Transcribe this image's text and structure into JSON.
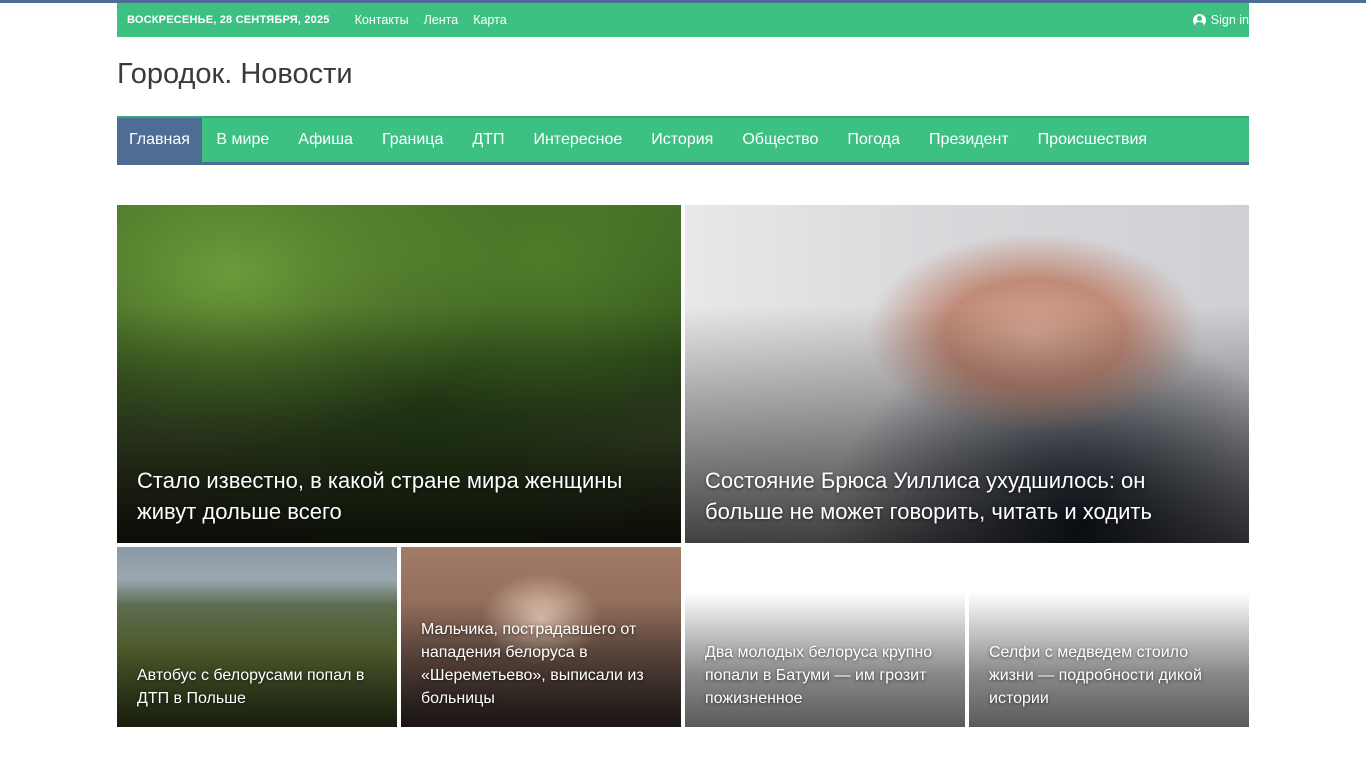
{
  "topbar": {
    "date": "Воскресенье, 28 сентября, 2025",
    "links": [
      "Контакты",
      "Лента",
      "Карта"
    ],
    "signin": "Sign in",
    "colors": {
      "bar": "#3cc182",
      "accent": "#4d6d94"
    }
  },
  "site": {
    "title": "Городок. Новости"
  },
  "nav": {
    "items": [
      "Главная",
      "В мире",
      "Афиша",
      "Граница",
      "ДТП",
      "Интересное",
      "История",
      "Общество",
      "Погода",
      "Президент",
      "Происшествия"
    ],
    "active_index": 0
  },
  "news": {
    "big": [
      {
        "title": "Стало известно, в какой стране мира женщины живут дольше всего",
        "image": "woman-on-bench-park"
      },
      {
        "title": "Состояние Брюса Уиллиса ухудшилось: он больше не может говорить, читать и ходить",
        "image": "bruce-willis-portrait"
      }
    ],
    "small": [
      {
        "title": "Автобус с белорусами попал в ДТП в Польше",
        "image": "bus-road-accident"
      },
      {
        "title": "Мальчика, пострадавшего от нападения белоруса в «Шереметьево», выписали из больницы",
        "image": "boy-in-car-seat"
      },
      {
        "title": "Два молодых белоруса крупно попали в Батуми — им грозит пожизненное",
        "image": ""
      },
      {
        "title": "Селфи с медведем стоило жизни — подробности дикой истории",
        "image": ""
      }
    ]
  }
}
